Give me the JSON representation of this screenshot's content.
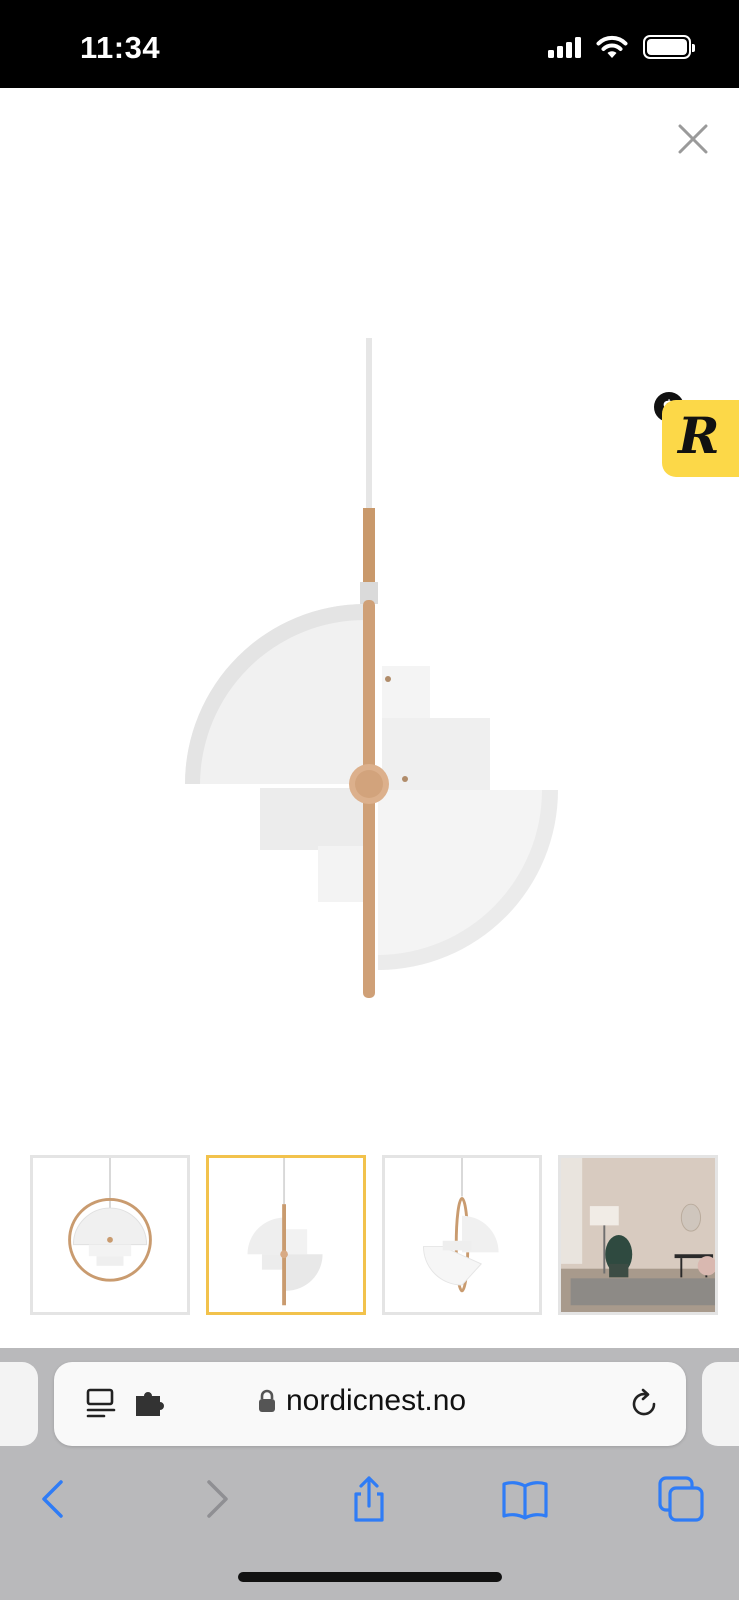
{
  "status_bar": {
    "time": "11:34",
    "icons": [
      "cellular-signal-icon",
      "wifi-icon",
      "battery-icon"
    ]
  },
  "viewer": {
    "close_icon": "close-icon",
    "main_image": "pendant-lamp-side-view",
    "extension_badge": {
      "letter": "R",
      "dollar": "$",
      "color": "#fcd848"
    },
    "thumbnails": [
      {
        "name": "lamp-front-view",
        "selected": false
      },
      {
        "name": "lamp-side-view",
        "selected": true
      },
      {
        "name": "lamp-angle-view",
        "selected": false
      },
      {
        "name": "lamp-in-living-room",
        "selected": false
      }
    ],
    "selected_border_color": "#f2c24c"
  },
  "safari": {
    "address": {
      "domain": "nordicnest.no",
      "left_icons": [
        "reader-mode-icon",
        "extensions-icon"
      ],
      "lock_icon": "lock-icon",
      "reload_icon": "reload-icon"
    },
    "nav": [
      "back-icon",
      "forward-icon",
      "share-icon",
      "bookmarks-icon",
      "tabs-icon"
    ],
    "accent_color": "#2f7cf6"
  }
}
